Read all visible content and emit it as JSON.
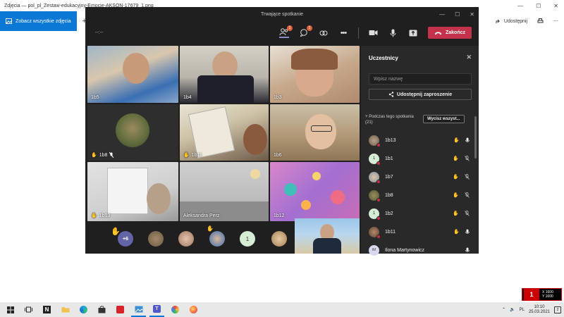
{
  "photos": {
    "title": "Zdjęcia — pol_pl_Zestaw-edukacyjny-Emocje-AKSON-17679_1.png",
    "see_all": "Zobacz wszystkie zdjęcia",
    "add_label": "Do",
    "share_label": "Udostępnij"
  },
  "teams": {
    "title": "Trwające spotkanie",
    "timer": "--:--",
    "chat_badge": "1",
    "people_badge": "1",
    "end_label": "Zakończ",
    "tiles": [
      {
        "label": "1b5",
        "hand": false
      },
      {
        "label": "1b4",
        "hand": false
      },
      {
        "label": "1b3",
        "hand": false
      },
      {
        "label": "1b8",
        "hand": true
      },
      {
        "label": "1b11",
        "hand": true
      },
      {
        "label": "1b6",
        "hand": false
      },
      {
        "label": "1b13",
        "hand": true
      },
      {
        "label": "Aleksandra Perz",
        "hand": false
      },
      {
        "label": "1b12",
        "hand": false
      }
    ],
    "strip": {
      "more_count": "+6",
      "avatar_initial": "1"
    }
  },
  "panel": {
    "title": "Uczestnicy",
    "search_placeholder": "Wpisz nazwę",
    "share_invite": "Udostępnij zaproszenie",
    "section_label": "Podczas tego spotkania (21)",
    "mute_all": "Wycisz wszyst...",
    "participants": [
      {
        "name": "1b13",
        "avatar": "photo",
        "initial": "",
        "hand": true,
        "muted": false
      },
      {
        "name": "1b1",
        "avatar": "initial",
        "initial": "1",
        "hand": true,
        "muted": true
      },
      {
        "name": "1b7",
        "avatar": "photo",
        "initial": "",
        "hand": true,
        "muted": true
      },
      {
        "name": "1b8",
        "avatar": "photo",
        "initial": "",
        "hand": true,
        "muted": true
      },
      {
        "name": "1b2",
        "avatar": "initial",
        "initial": "1",
        "hand": true,
        "muted": true
      },
      {
        "name": "1b11",
        "avatar": "photo",
        "initial": "",
        "hand": true,
        "muted": false
      },
      {
        "name": "Ilona Martynowicz",
        "avatar": "initial",
        "initial": "IM",
        "hand": false,
        "muted": false
      }
    ]
  },
  "taskbar": {
    "time": "10:10",
    "date": "25.03.2021",
    "notif_count": "2"
  },
  "overlay": {
    "logo": "1",
    "x_res": "X 1600",
    "y_res": "Y 1600"
  }
}
